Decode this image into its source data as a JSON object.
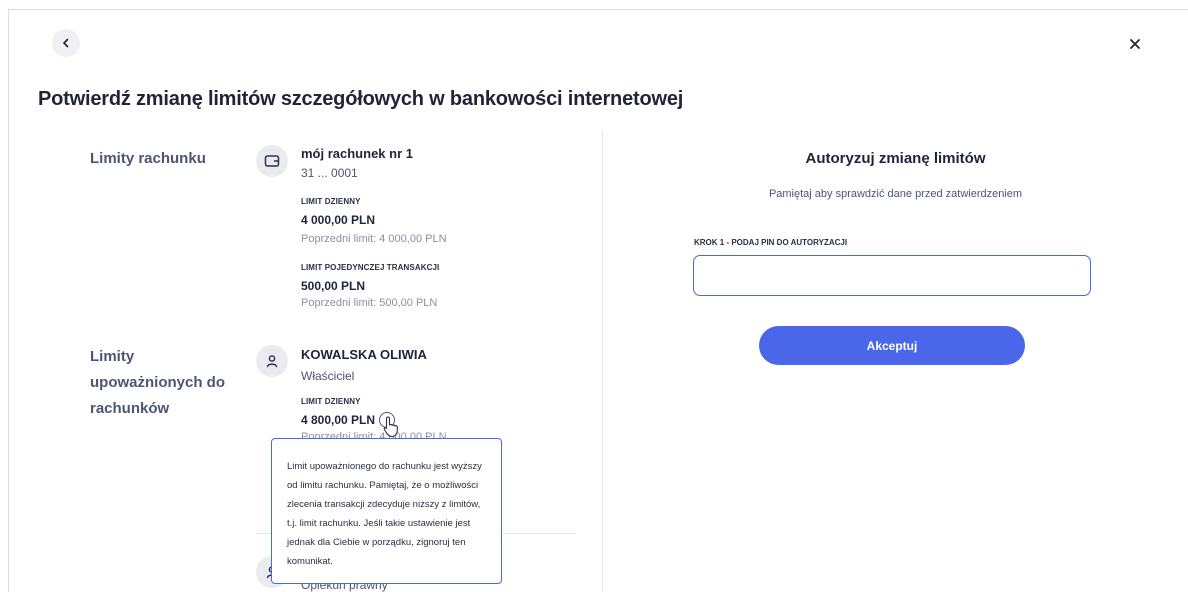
{
  "header": {
    "title": "Potwierdź zmianę limitów szczegółowych w bankowości internetowej"
  },
  "icons": {
    "back": "chevron-left-icon",
    "close": "close-icon",
    "wallet": "wallet-icon",
    "person": "person-icon",
    "info": "info-icon",
    "cursor": "pointer-cursor-icon"
  },
  "colors": {
    "accent": "#4a67ea",
    "text_dark": "#1f2439",
    "text_muted": "#8a90a5"
  },
  "left": {
    "account_section_label": "Limity rachunku",
    "account": {
      "name": "mój rachunek nr 1",
      "number": "31 ... 0001",
      "daily_caption": "LIMIT DZIENNY",
      "daily_amount": "4 000,00 PLN",
      "daily_previous": "Poprzedni limit: 4 000,00 PLN",
      "single_caption": "LIMIT POJEDYNCZEJ TRANSAKCJI",
      "single_amount": "500,00 PLN",
      "single_previous": "Poprzedni limit: 500,00 PLN"
    },
    "authorized_section_label": "Limity upoważnionych do rachunków",
    "authorized": {
      "name": "KOWALSKA OLIWIA",
      "role": "Właściciel",
      "daily_caption": "LIMIT DZIENNY",
      "daily_amount": "4 800,00 PLN",
      "daily_previous": "Poprzedni limit: 4 000,00 PLN"
    },
    "second_person_role": "Opiekun prawny",
    "tooltip": "Limit upoważnionego do rachunku jest wyższy od limitu rachunku. Pamiętaj, że o możliwości zlecenia transakcji zdecyduje niższy z limitów, t.j. limit rachunku. Jeśli takie ustawienie jest jednak dla Ciebie w porządku, zignoruj ten komunikat."
  },
  "auth": {
    "title": "Autoryzuj zmianę limitów",
    "subtitle": "Pamiętaj aby sprawdzić dane przed zatwierdzeniem",
    "step_label": "KROK 1 - PODAJ PIN DO AUTORYZACJI",
    "pin_value": "",
    "accept_label": "Akceptuj"
  }
}
